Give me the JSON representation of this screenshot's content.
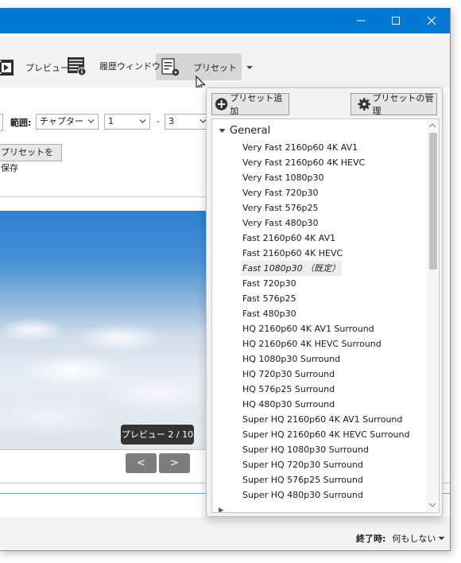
{
  "window": {
    "controls": {
      "minimize": "minimize-icon",
      "maximize": "maximize-icon",
      "close": "close-icon"
    }
  },
  "toolbar": {
    "preview_label": "プレビュー",
    "history_label": "履歴ウィンドウ",
    "presets_label": "プリセット"
  },
  "range": {
    "label": "範囲:",
    "mode": "チャプター",
    "start": "1",
    "separator": "-",
    "end": "3"
  },
  "save_preset_button": "プリセットを保存",
  "preview": {
    "counter": "プレビュー 2 / 10",
    "prev": "<",
    "next": ">"
  },
  "footer": {
    "when_done_label": "終了時:",
    "when_done_value": "何もしない"
  },
  "presets_panel": {
    "add_button": "プリセット追加",
    "manage_button": "プリセットの管理",
    "group": "General",
    "items": [
      "Very Fast 2160p60 4K AV1",
      "Very Fast 2160p60 4K HEVC",
      "Very Fast 1080p30",
      "Very Fast 720p30",
      "Very Fast 576p25",
      "Very Fast 480p30",
      "Fast 2160p60 4K AV1",
      "Fast 2160p60 4K HEVC",
      "Fast 1080p30 （既定）",
      "Fast 720p30",
      "Fast 576p25",
      "Fast 480p30",
      "HQ 2160p60 4K AV1 Surround",
      "HQ 2160p60 4K HEVC Surround",
      "HQ 1080p30 Surround",
      "HQ 720p30 Surround",
      "HQ 576p25 Surround",
      "HQ 480p30 Surround",
      "Super HQ 2160p60 4K AV1 Surround",
      "Super HQ 2160p60 4K HEVC Surround",
      "Super HQ 1080p30 Surround",
      "Super HQ 720p30 Surround",
      "Super HQ 576p25 Surround",
      "Super HQ 480p30 Surround"
    ],
    "default_index": 8
  },
  "colors": {
    "titlebar": "#0078d4"
  }
}
